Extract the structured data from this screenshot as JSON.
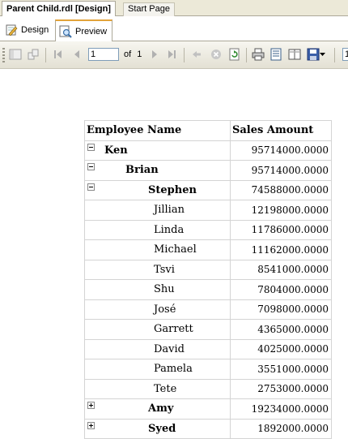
{
  "doc_tabs": [
    {
      "label": "Parent Child.rdl [Design]",
      "active": true
    },
    {
      "label": "Start Page",
      "active": false
    }
  ],
  "view_tabs": {
    "design": "Design",
    "preview": "Preview"
  },
  "toolbar": {
    "page_value": "1",
    "of_label": "of",
    "total_pages": "1",
    "zoom_value": "1"
  },
  "report": {
    "headers": [
      "Employee Name",
      "Sales Amount"
    ],
    "rows": [
      {
        "name": "Ken",
        "amount": "95714000.0000",
        "level": 0,
        "toggle": "minus",
        "bold": true
      },
      {
        "name": "Brian",
        "amount": "95714000.0000",
        "level": 1,
        "toggle": "minus",
        "bold": true
      },
      {
        "name": "Stephen",
        "amount": "74588000.0000",
        "level": 2,
        "toggle": "minus",
        "bold": true
      },
      {
        "name": "Jillian",
        "amount": "12198000.0000",
        "level": 3,
        "toggle": "",
        "bold": false
      },
      {
        "name": "Linda",
        "amount": "11786000.0000",
        "level": 3,
        "toggle": "",
        "bold": false
      },
      {
        "name": "Michael",
        "amount": "11162000.0000",
        "level": 3,
        "toggle": "",
        "bold": false
      },
      {
        "name": "Tsvi",
        "amount": "8541000.0000",
        "level": 3,
        "toggle": "",
        "bold": false
      },
      {
        "name": "Shu",
        "amount": "7804000.0000",
        "level": 3,
        "toggle": "",
        "bold": false
      },
      {
        "name": "José",
        "amount": "7098000.0000",
        "level": 3,
        "toggle": "",
        "bold": false
      },
      {
        "name": "Garrett",
        "amount": "4365000.0000",
        "level": 3,
        "toggle": "",
        "bold": false
      },
      {
        "name": "David",
        "amount": "4025000.0000",
        "level": 3,
        "toggle": "",
        "bold": false
      },
      {
        "name": "Pamela",
        "amount": "3551000.0000",
        "level": 3,
        "toggle": "",
        "bold": false
      },
      {
        "name": "Tete",
        "amount": "2753000.0000",
        "level": 3,
        "toggle": "",
        "bold": false
      },
      {
        "name": "Amy",
        "amount": "19234000.0000",
        "level": 2,
        "toggle": "plus",
        "bold": true
      },
      {
        "name": "Syed",
        "amount": "1892000.0000",
        "level": 2,
        "toggle": "plus",
        "bold": true
      }
    ]
  }
}
